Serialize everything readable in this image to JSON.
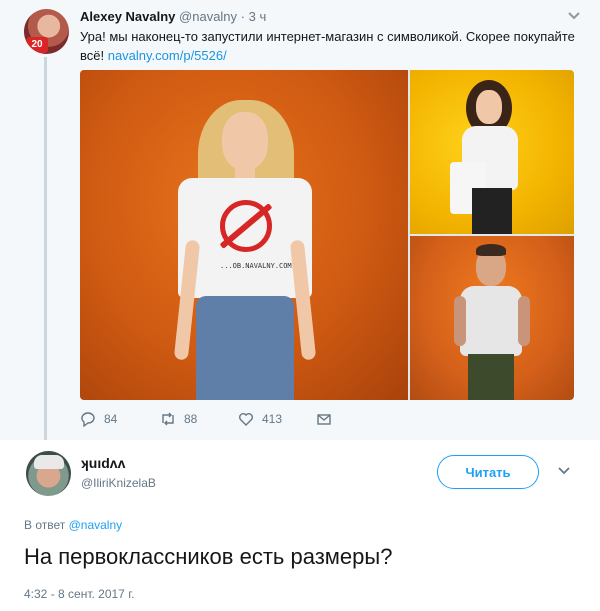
{
  "top_tweet": {
    "author_name": "Alexey Navalny",
    "author_handle": "@navalny",
    "separator": "·",
    "time": "3 ч",
    "badge": "20",
    "text": "Ура! мы наконец-то запустили интернет-магазин с символикой. Скорее покупайте всё! ",
    "link": "navalny.com/p/5526/",
    "shirt_print": "...OB.NAVALNY.COM",
    "actions": {
      "replies": "84",
      "retweets": "88",
      "likes": "413"
    }
  },
  "reply_tweet": {
    "author_name": "ʞuıdʌʌ",
    "author_handle": "@IliriKnizelaB",
    "follow_label": "Читать",
    "in_reply_prefix": "В ответ ",
    "in_reply_handle": "@navalny",
    "text": "На первоклассников есть размеры?",
    "timestamp": "4:32 - 8 сент. 2017 г."
  },
  "colors": {
    "accent": "#1da1f2",
    "link": "#1b95e0",
    "muted": "#657786",
    "badge_red": "#d92525",
    "quoted_bg": "#f5f8fa"
  },
  "icons": {
    "reply": "reply-icon",
    "retweet": "retweet-icon",
    "like": "heart-icon",
    "message": "envelope-icon",
    "caret": "chevron-down-icon"
  }
}
